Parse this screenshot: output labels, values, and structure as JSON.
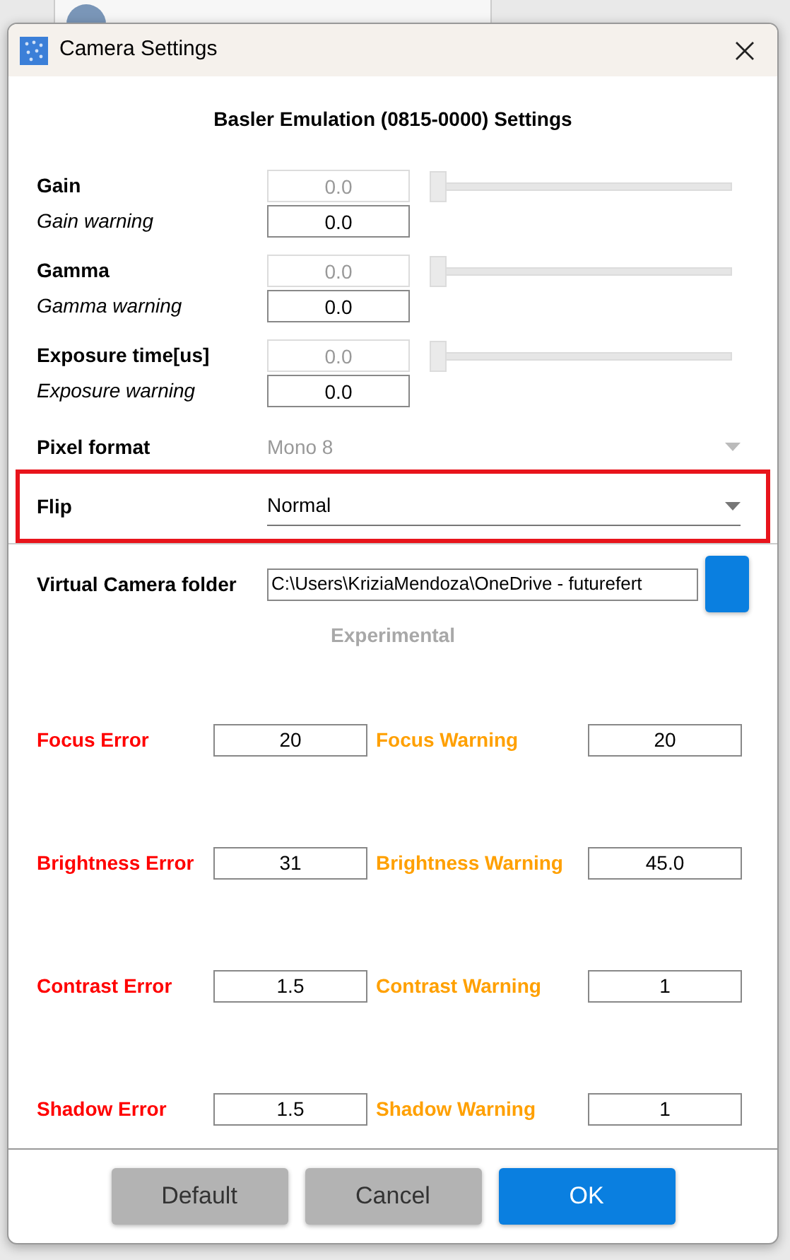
{
  "window": {
    "title": "Camera Settings"
  },
  "heading": "Basler Emulation (0815-0000) Settings",
  "parameters": [
    {
      "label": "Gain",
      "value": "0.0",
      "disabled": true,
      "level": 0,
      "warning_label": "Gain warning",
      "warning_value": "0.0"
    },
    {
      "label": "Gamma",
      "value": "0.0",
      "disabled": true,
      "level": 0,
      "warning_label": "Gamma warning",
      "warning_value": "0.0"
    },
    {
      "label": "Exposure time[us]",
      "value": "0.0",
      "disabled": true,
      "level": 0,
      "warning_label": "Exposure warning",
      "warning_value": "0.0"
    }
  ],
  "dropdowns": [
    {
      "label": "Pixel format",
      "value": "Mono 8",
      "disabled": true,
      "highlighted": false
    },
    {
      "label": "Flip",
      "value": "Normal",
      "disabled": false,
      "highlighted": true
    }
  ],
  "folder": {
    "label": "Virtual Camera folder",
    "value": "C:\\Users\\KriziaMendoza\\OneDrive - futurefert"
  },
  "section_title": "Experimental",
  "thresholds": [
    {
      "error_label": "Focus Error",
      "error_value": "20",
      "warning_label": "Focus Warning",
      "warning_value": "20"
    },
    {
      "error_label": "Brightness Error",
      "error_value": "31",
      "warning_label": "Brightness Warning",
      "warning_value": "45.0"
    },
    {
      "error_label": "Contrast Error",
      "error_value": "1.5",
      "warning_label": "Contrast Warning",
      "warning_value": "1"
    },
    {
      "error_label": "Shadow Error",
      "error_value": "1.5",
      "warning_label": "Shadow Warning",
      "warning_value": "1"
    }
  ],
  "buttons": [
    {
      "label": "Default",
      "kind": "secondary"
    },
    {
      "label": "Cancel",
      "kind": "secondary"
    },
    {
      "label": "OK",
      "kind": "primary"
    }
  ]
}
